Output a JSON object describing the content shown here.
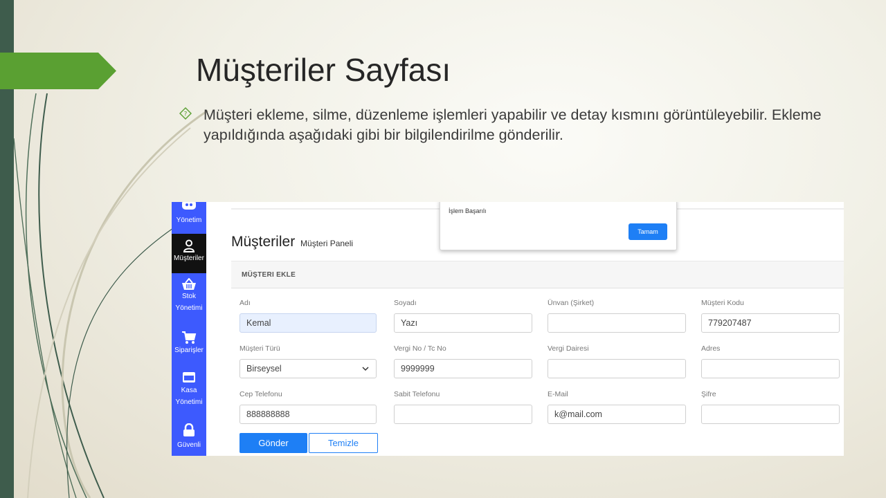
{
  "slide": {
    "title": "Müşteriler Sayfası",
    "bullet": "Müşteri ekleme, silme, düzenleme işlemleri yapabilir ve detay kısmını görüntüleyebilir. Ekleme yapıldığında aşağıdaki gibi bir bilgilendirilme gönderilir.",
    "accent_color": "#5aa032",
    "band_color": "#3e5c4c"
  },
  "sidebar": {
    "items": [
      {
        "label": "Yönetim",
        "icon": "dashboard-icon"
      },
      {
        "label": "Müşteriler",
        "icon": "user-icon",
        "active": true
      },
      {
        "label": "Stok Yönetimi",
        "icon": "basket-icon"
      },
      {
        "label": "Siparişler",
        "icon": "cart-icon"
      },
      {
        "label": "Kasa Yönetimi",
        "icon": "card-icon"
      },
      {
        "label": "Güvenli",
        "icon": "lock-icon"
      }
    ],
    "color": "#3d5afe"
  },
  "page": {
    "title": "Müşteriler",
    "subtitle": "Müşteri Paneli"
  },
  "card": {
    "header": "MÜŞTERI EKLE"
  },
  "form": {
    "ad": {
      "label": "Adı",
      "value": "Kemal"
    },
    "soyad": {
      "label": "Soyadı",
      "value": "Yazı"
    },
    "unvan": {
      "label": "Ünvan (Şirket)",
      "value": ""
    },
    "kod": {
      "label": "Müşteri Kodu",
      "value": "779207487"
    },
    "tur": {
      "label": "Müşteri Türü",
      "value": "Birseysel"
    },
    "vergi_no": {
      "label": "Vergi No / Tc No",
      "value": "9999999"
    },
    "vergi_dairesi": {
      "label": "Vergi Dairesi",
      "value": ""
    },
    "adres": {
      "label": "Adres",
      "value": ""
    },
    "cep": {
      "label": "Cep Telefonu",
      "value": "888888888"
    },
    "sabit": {
      "label": "Sabit Telefonu",
      "value": ""
    },
    "email": {
      "label": "E-Mail",
      "value": "k@mail.com"
    },
    "sifre": {
      "label": "Şifre",
      "value": ""
    },
    "submit_label": "Gönder",
    "clear_label": "Temizle"
  },
  "modal": {
    "message": "İşlem Başarılı",
    "ok_label": "Tamam"
  }
}
